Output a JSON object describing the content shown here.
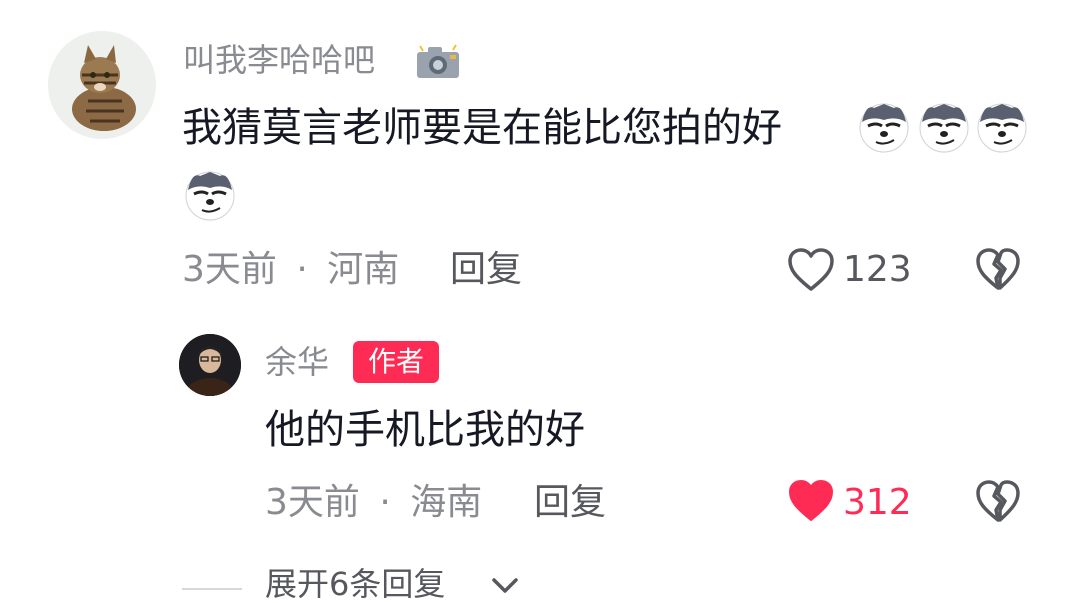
{
  "comment": {
    "username": "叫我李哈哈吧",
    "username_icon": "camera-icon",
    "text": "我猜莫言老师要是在能比您拍的好",
    "emojis": [
      "wolf-smirk-emoji",
      "wolf-smirk-emoji",
      "wolf-smirk-emoji",
      "wolf-smirk-emoji"
    ],
    "time": "3天前",
    "separator": "·",
    "location": "河南",
    "reply_label": "回复",
    "like_count": "123",
    "liked": false
  },
  "reply": {
    "username": "余华",
    "badge": "作者",
    "text": "他的手机比我的好",
    "time": "3天前",
    "separator": "·",
    "location": "海南",
    "reply_label": "回复",
    "like_count": "312",
    "liked": true
  },
  "expand": {
    "label": "展开6条回复",
    "icon": "chevron-down-icon"
  },
  "colors": {
    "accent": "#fe2c55",
    "secondary_text": "#8a8b91",
    "primary_text": "#161823"
  }
}
